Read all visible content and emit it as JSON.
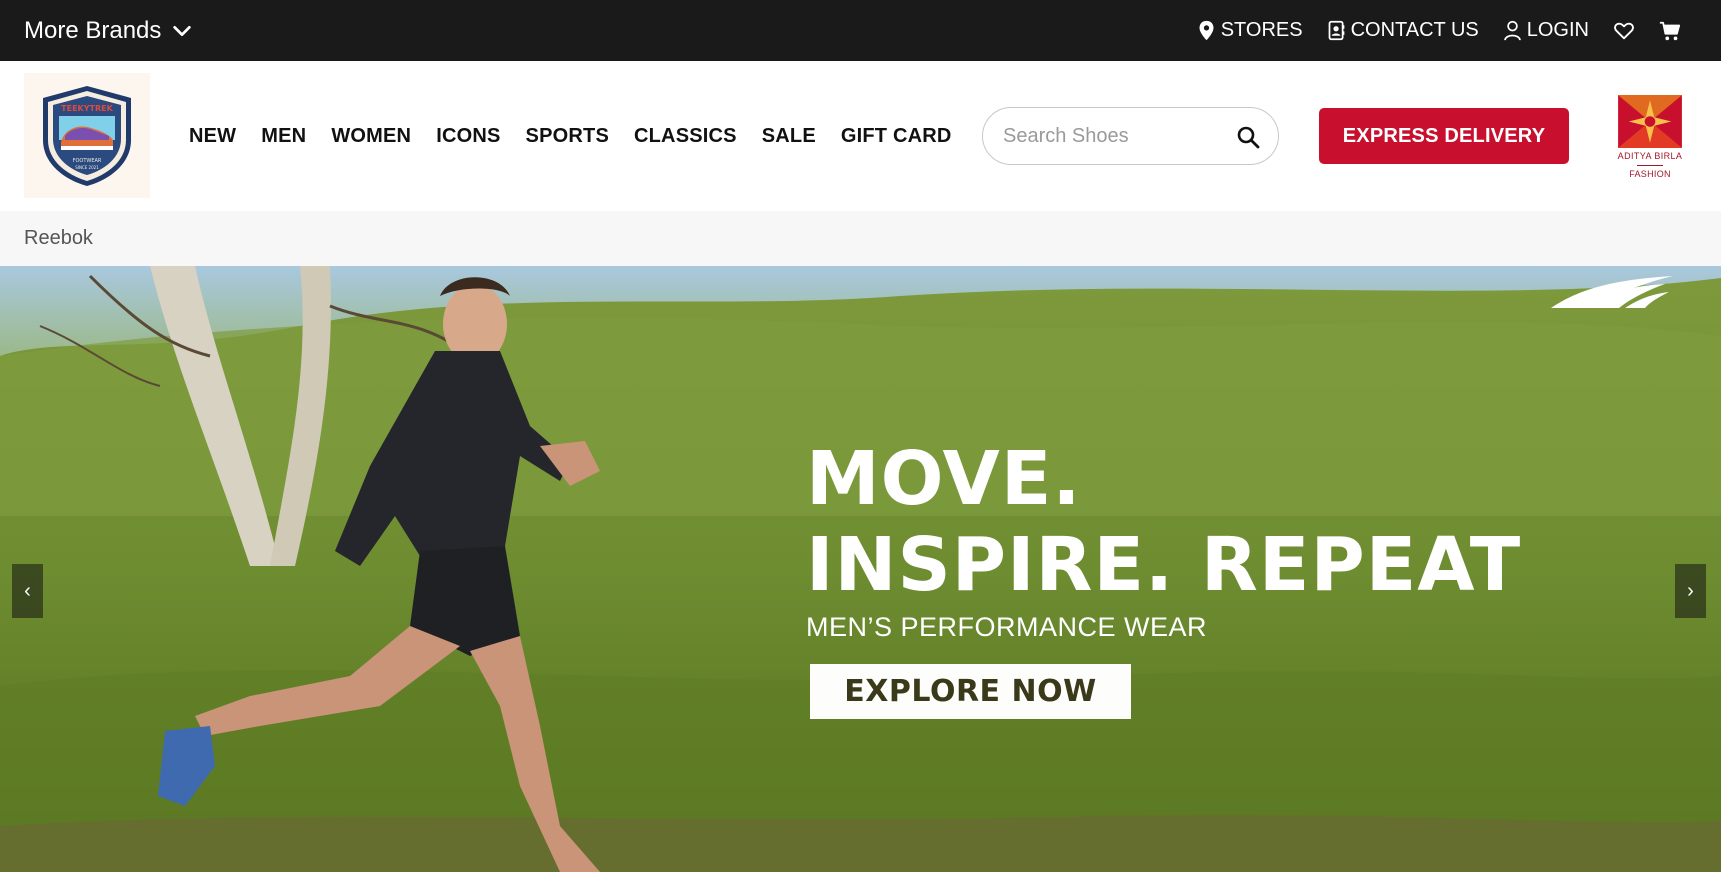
{
  "topbar": {
    "brands_label": "More Brands",
    "links": [
      {
        "label": "STORES",
        "icon": "map-pin-icon"
      },
      {
        "label": "CONTACT US",
        "icon": "contact-card-icon"
      },
      {
        "label": "LOGIN",
        "icon": "user-icon"
      }
    ],
    "icons": [
      "heart-icon",
      "cart-icon"
    ]
  },
  "header": {
    "logo_name": "teekytrek-logo",
    "nav": [
      "NEW",
      "MEN",
      "WOMEN",
      "ICONS",
      "SPORTS",
      "CLASSICS",
      "SALE",
      "GIFT CARD"
    ],
    "search_placeholder": "Search Shoes",
    "express_label": "EXPRESS DELIVERY",
    "partner": {
      "name": "ADITYA BIRLA",
      "sub": "FASHION"
    }
  },
  "breadcrumb": "Reebok",
  "hero": {
    "line1": "MOVE.",
    "line2": "INSPIRE. REPEAT",
    "subtitle": "MEN’S PERFORMANCE WEAR",
    "cta": "EXPLORE NOW",
    "prev": "‹",
    "next": "›"
  },
  "colors": {
    "topbar": "#1a1a1a",
    "accent": "#c8102e",
    "partner": "#a0172d"
  }
}
